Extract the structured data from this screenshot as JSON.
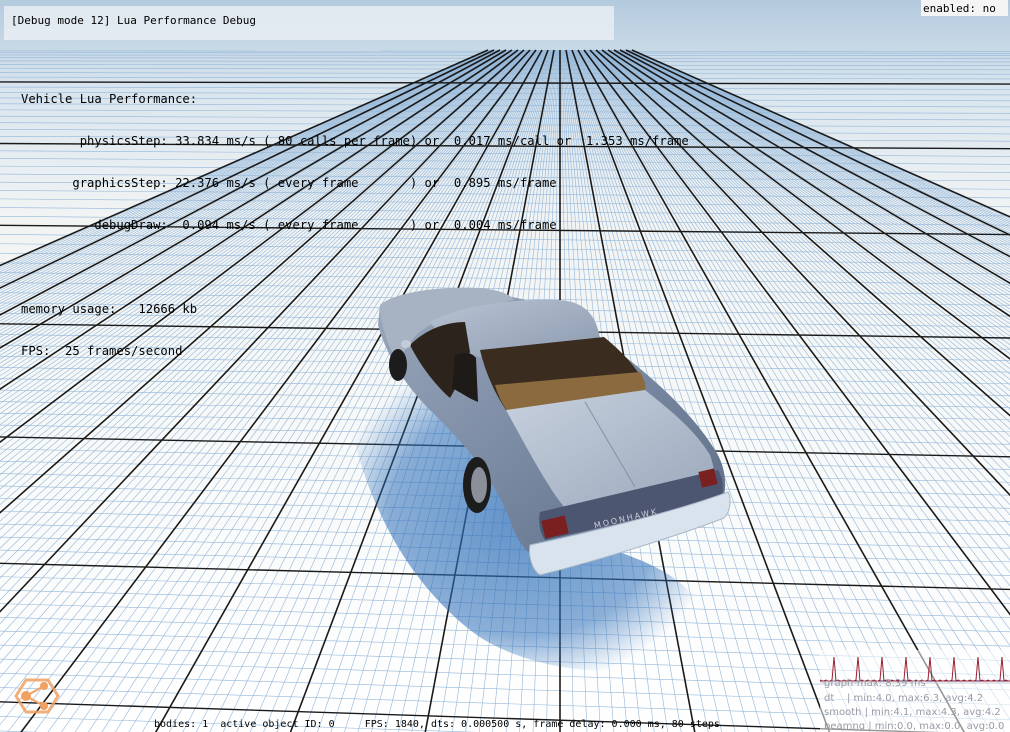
{
  "window": {
    "title": "[Debug mode 12] Lua Performance Debug",
    "enabled_status": "enabled: no"
  },
  "perf": {
    "lines": [
      "Vehicle Lua Performance:",
      "        physicsStep: 33.834 ms/s ( 80 calls per frame) or  0.017 ms/call or  1.353 ms/frame",
      "       graphicsStep: 22.376 ms/s ( every frame       ) or  0.895 ms/frame",
      "          debugDraw:  0.094 ms/s ( every frame       ) or  0.004 ms/frame",
      "",
      "memory usage:   12666 kb",
      "FPS:  25 frames/second"
    ]
  },
  "graph": {
    "lines": [
      "graph-max: 8.39 ms",
      "dt    | min:4.0, max:6.3, avg:4.2",
      "smooth | min:4.1, max:4.3, avg:4.2",
      "beamng | min:0.0, max:0.0, avg:0.0"
    ],
    "colors": {
      "dt": "#9b2030",
      "smooth": "#4a2a6a"
    }
  },
  "status_bar": {
    "text": "bodies: 1  active object ID: 0     FPS: 1840, dts: 0.000500 s, frame delay: 0.000 ms, 80 steps"
  },
  "scene": {
    "vehicle": "Moonhawk",
    "plate_text": "MOONHAWK",
    "colors": {
      "sky_top": "#b8cfe0",
      "ground": "#f4f8fb",
      "grid_minor": "#8fb3d6",
      "grid_major": "#1b1b1b",
      "car_body": "#7e8ea6"
    }
  },
  "logo": {
    "icon": "beamng-logo-icon",
    "color": "#f0a060"
  }
}
